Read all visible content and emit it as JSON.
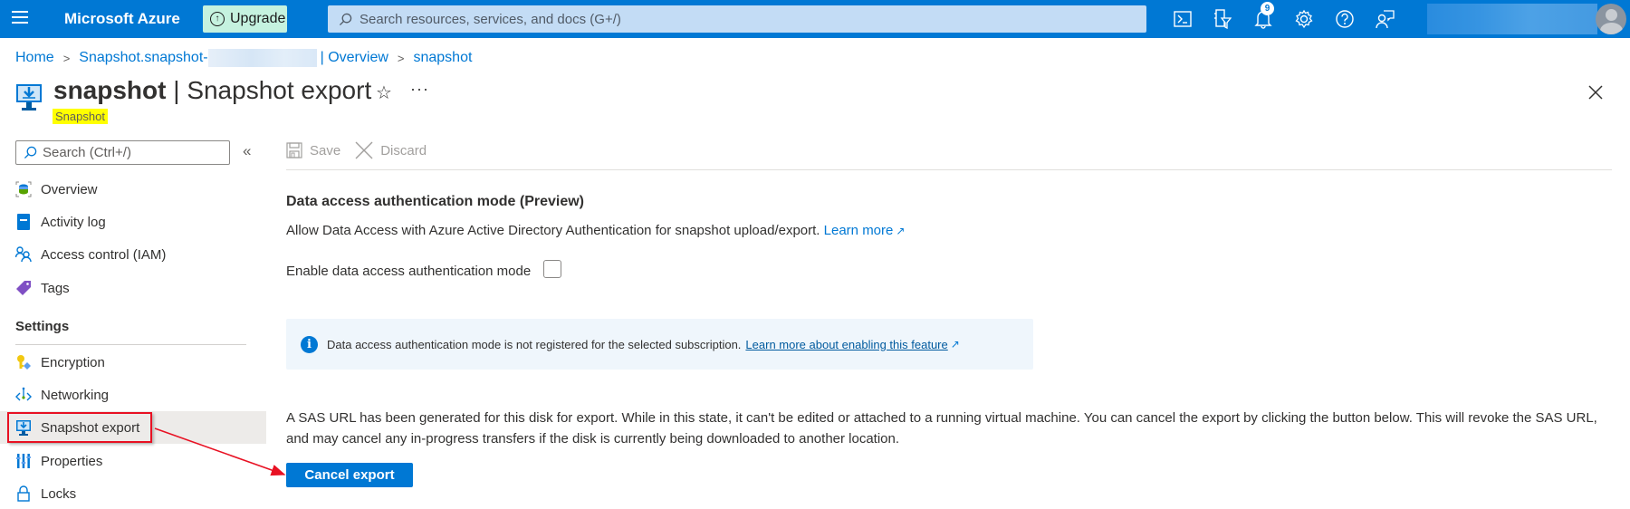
{
  "topbar": {
    "brand": "Microsoft Azure",
    "upgrade_label": "Upgrade",
    "search_placeholder": "Search resources, services, and docs (G+/)",
    "notification_count": "9",
    "icons": [
      "cloud-shell-icon",
      "directory-filter-icon",
      "notifications-icon",
      "settings-icon",
      "help-icon",
      "feedback-icon"
    ]
  },
  "breadcrumb": {
    "items": [
      "Home",
      "Snapshot.snapshot-",
      "| Overview",
      "snapshot"
    ],
    "separator": ">"
  },
  "header": {
    "resource_name": "snapshot",
    "title_separator": " | ",
    "page_name": "Snapshot export",
    "subtitle": "Snapshot",
    "more_label": "···"
  },
  "sidebar": {
    "search_placeholder": "Search (Ctrl+/)",
    "collapse_label": "«",
    "items": [
      {
        "label": "Overview",
        "icon": "overview-icon"
      },
      {
        "label": "Activity log",
        "icon": "activity-log-icon"
      },
      {
        "label": "Access control (IAM)",
        "icon": "iam-icon"
      },
      {
        "label": "Tags",
        "icon": "tag-icon"
      }
    ],
    "settings_heading": "Settings",
    "settings_items": [
      {
        "label": "Encryption",
        "icon": "key-icon"
      },
      {
        "label": "Networking",
        "icon": "networking-icon"
      },
      {
        "label": "Snapshot export",
        "icon": "snapshot-export-icon",
        "active": true
      },
      {
        "label": "Properties",
        "icon": "properties-icon"
      },
      {
        "label": "Locks",
        "icon": "lock-icon"
      }
    ]
  },
  "toolbar": {
    "save_label": "Save",
    "discard_label": "Discard"
  },
  "main": {
    "section_title": "Data access authentication mode (Preview)",
    "section_desc": "Allow Data Access with Azure Active Directory Authentication for snapshot upload/export.",
    "learn_more": "Learn more",
    "checkbox_label": "Enable data access authentication mode",
    "checkbox_checked": false,
    "info_text": "Data access authentication mode is not registered for the selected subscription.",
    "info_link": "Learn more about enabling this feature",
    "sas_text": "A SAS URL has been generated for this disk for export. While in this state, it can't be edited or attached to a running virtual machine. You can cancel the export by clicking the button below. This will revoke the SAS URL, and may cancel any in-progress transfers if the disk is currently being downloaded to another location.",
    "cancel_export_label": "Cancel export"
  },
  "colors": {
    "azure_blue": "#0078d4",
    "upgrade_bg": "#c5f2df",
    "highlight_yellow": "#ffff00",
    "annotation_red": "#e81123",
    "info_bg": "#eff6fc"
  }
}
